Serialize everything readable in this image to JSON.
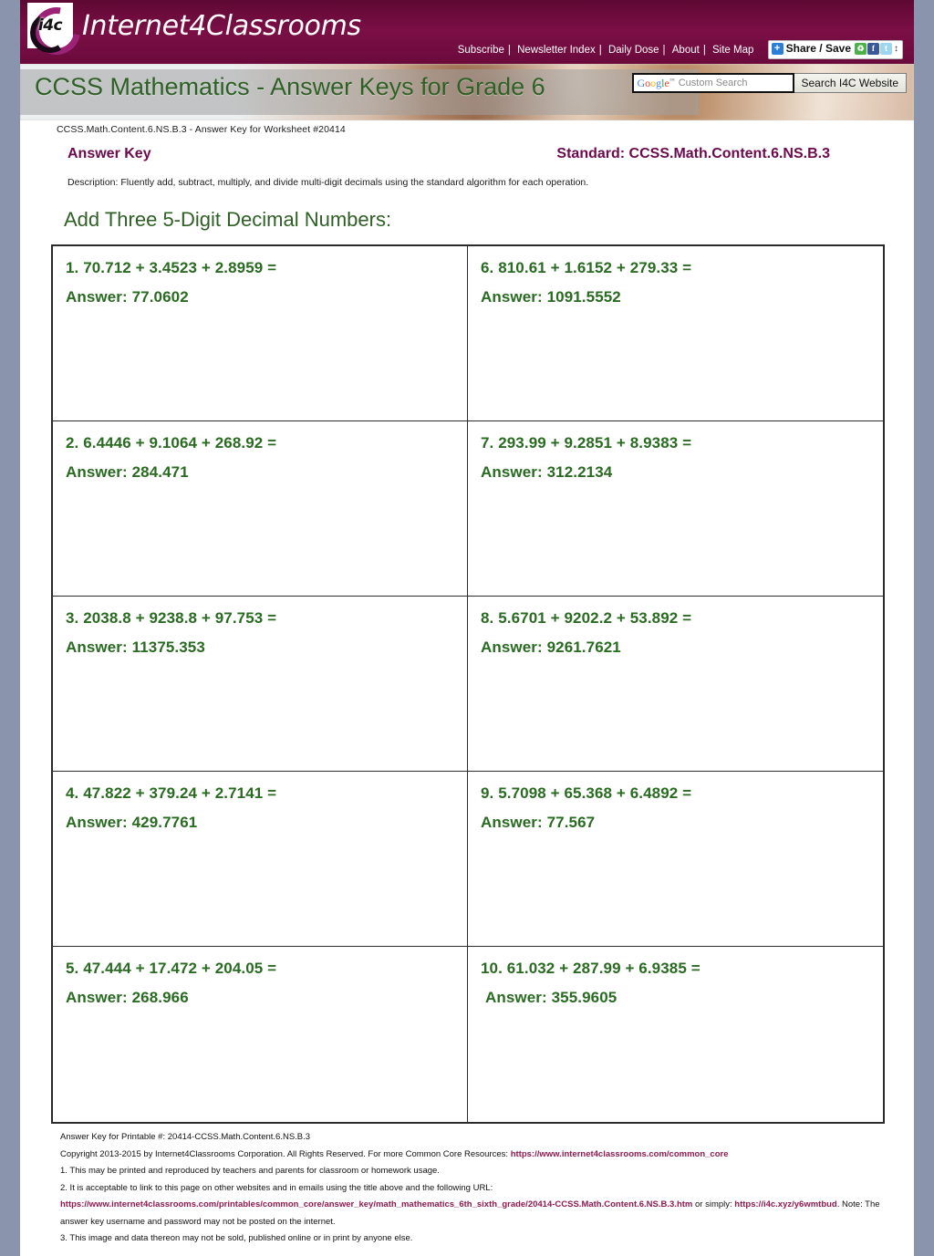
{
  "site": {
    "logo_badge": "i4c",
    "logo_text": "Internet4Classrooms"
  },
  "topnav": {
    "items": [
      "Subscribe",
      "Newsletter Index",
      "Daily Dose",
      "About",
      "Site Map"
    ],
    "share_label": "Share / Save",
    "share_plus": "+",
    "icon_share": "♻",
    "icon_facebook": "f",
    "icon_twitter": "t",
    "icon_arrows": "↕"
  },
  "banner": {
    "title": "CCSS Mathematics - Answer Keys for Grade 6"
  },
  "search": {
    "google_mark": "Google",
    "trademark": "™",
    "placeholder": "Custom Search",
    "value": "",
    "button_label": "Search I4C Website"
  },
  "worksheet": {
    "reference": "CCSS.Math.Content.6.NS.B.3 - Answer Key for Worksheet #20414",
    "answer_key_label": "Answer Key",
    "standard_label": "Standard: CCSS.Math.Content.6.NS.B.3",
    "description": "Description: Fluently add, subtract, multiply, and divide multi-digit decimals using the standard algorithm for each operation.",
    "section_title": "Add Three 5-Digit Decimal Numbers:"
  },
  "problems": [
    {
      "question": "1. 70.712 + 3.4523 + 2.8959 =",
      "answer": "Answer: 77.0602"
    },
    {
      "question": "6. 810.61 + 1.6152 + 279.33 =",
      "answer": "Answer: 1091.5552"
    },
    {
      "question": "2. 6.4446 + 9.1064 + 268.92 =",
      "answer": "Answer: 284.471"
    },
    {
      "question": "7. 293.99 + 9.2851 + 8.9383 =",
      "answer": "Answer: 312.2134"
    },
    {
      "question": "3. 2038.8 + 9238.8 + 97.753 =",
      "answer": "Answer: 11375.353"
    },
    {
      "question": "8. 5.6701 + 9202.2 + 53.892 =",
      "answer": "Answer: 9261.7621"
    },
    {
      "question": "4. 47.822 + 379.24 + 2.7141 =",
      "answer": "Answer: 429.7761"
    },
    {
      "question": "9. 5.7098 + 65.368 + 6.4892 =",
      "answer": "Answer: 77.567"
    },
    {
      "question": "5. 47.444 + 17.472 + 204.05 =",
      "answer": "Answer: 268.966"
    },
    {
      "question": "10. 61.032 + 287.99 + 6.9385 =",
      "answer": "Answer: 355.9605"
    }
  ],
  "footer": {
    "printable": "Answer Key for Printable #: 20414-CCSS.Math.Content.6.NS.B.3",
    "copyright_prefix": "Copyright 2013-2015 by Internet4Classrooms Corporation. All Rights Reserved. For more Common Core Resources: ",
    "copyright_link": "https://www.internet4classrooms.com/common_core",
    "note1": "1. This may be printed and reproduced by teachers and parents for classroom or homework usage.",
    "note2": "2. It is acceptable to link to this page on other websites and in emails using the title above and the following URL:",
    "note2_url": "https://www.internet4classrooms.com/printables/common_core/answer_key/math_mathematics_6th_sixth_grade/20414-CCSS.Math.Content.6.NS.B.3.htm",
    "note2_mid": " or simply: ",
    "note2_short": "https://i4c.xyz/y6wmtbud",
    "note2_tail": ". Note: The answer key username and password may not be posted on the internet.",
    "note3": "3. This image and data thereon may not be sold, published online or in print by anyone else."
  }
}
